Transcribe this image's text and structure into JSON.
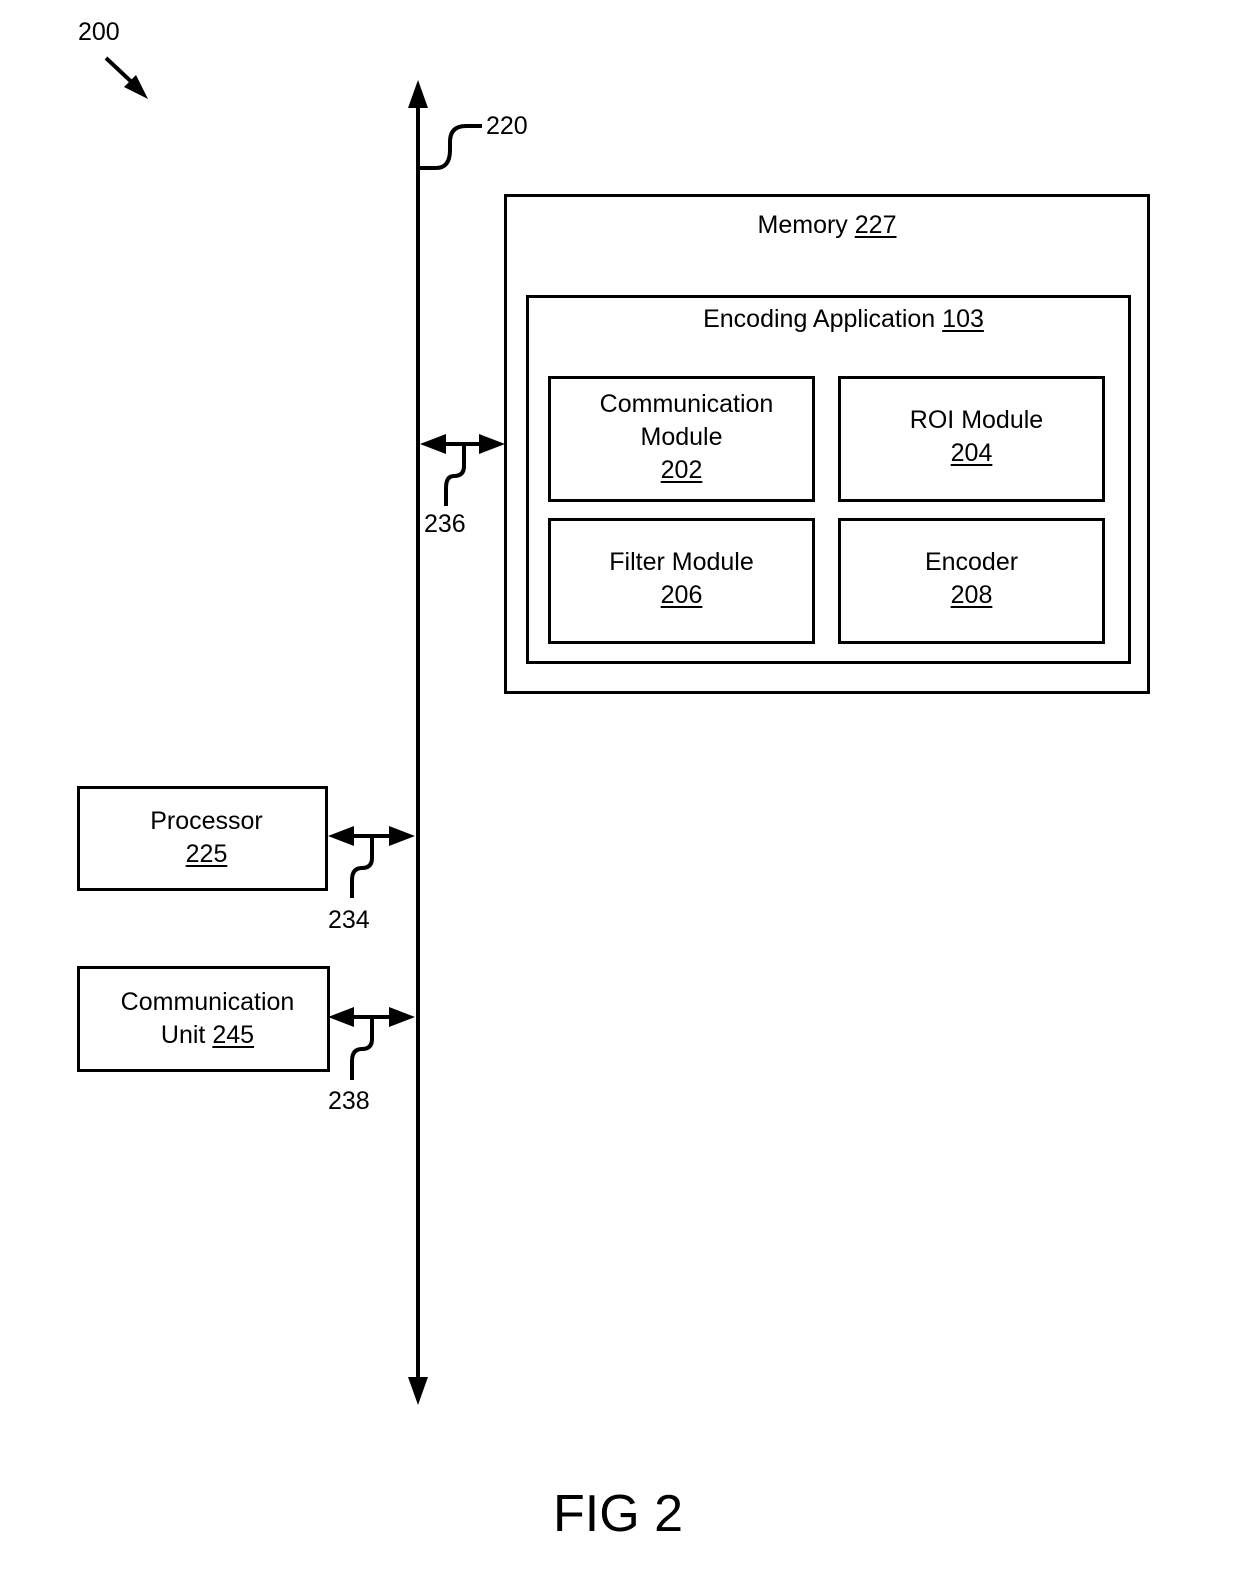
{
  "figure": {
    "number_label": "200",
    "caption": "FIG 2"
  },
  "bus": {
    "ref": "220"
  },
  "memory": {
    "title": "Memory",
    "ref": "227",
    "application": {
      "title": "Encoding Application",
      "ref": "103",
      "modules": [
        {
          "line1": "Communication",
          "line2": "Module",
          "ref": "202"
        },
        {
          "line1": "ROI Module",
          "line2": "",
          "ref": "204"
        },
        {
          "line1": "Filter Module",
          "line2": "",
          "ref": "206"
        },
        {
          "line1": "Encoder",
          "line2": "",
          "ref": "208"
        }
      ]
    }
  },
  "processor": {
    "title": "Processor",
    "ref": "225"
  },
  "comm_unit": {
    "line1": "Communication",
    "line2": "Unit",
    "ref": "245"
  },
  "connections": {
    "memory_link": "236",
    "processor_link": "234",
    "comm_unit_link": "238"
  }
}
